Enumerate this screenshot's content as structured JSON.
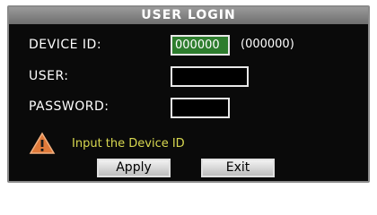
{
  "dialog": {
    "title": "USER LOGIN",
    "device_id": {
      "label": "DEVICE ID:",
      "value": "000000",
      "hint": "(000000)"
    },
    "user": {
      "label": "USER:",
      "value": ""
    },
    "password": {
      "label": "PASSWORD:",
      "value": ""
    },
    "warning": {
      "icon": "warning-triangle-icon",
      "text": "Input the Device ID"
    },
    "buttons": {
      "apply": "Apply",
      "exit": "Exit"
    }
  },
  "colors": {
    "background": "#0a0a0a",
    "active_field": "#2e7d2e",
    "warning_text": "#d8d850",
    "warning_icon": "#e07a3a"
  }
}
